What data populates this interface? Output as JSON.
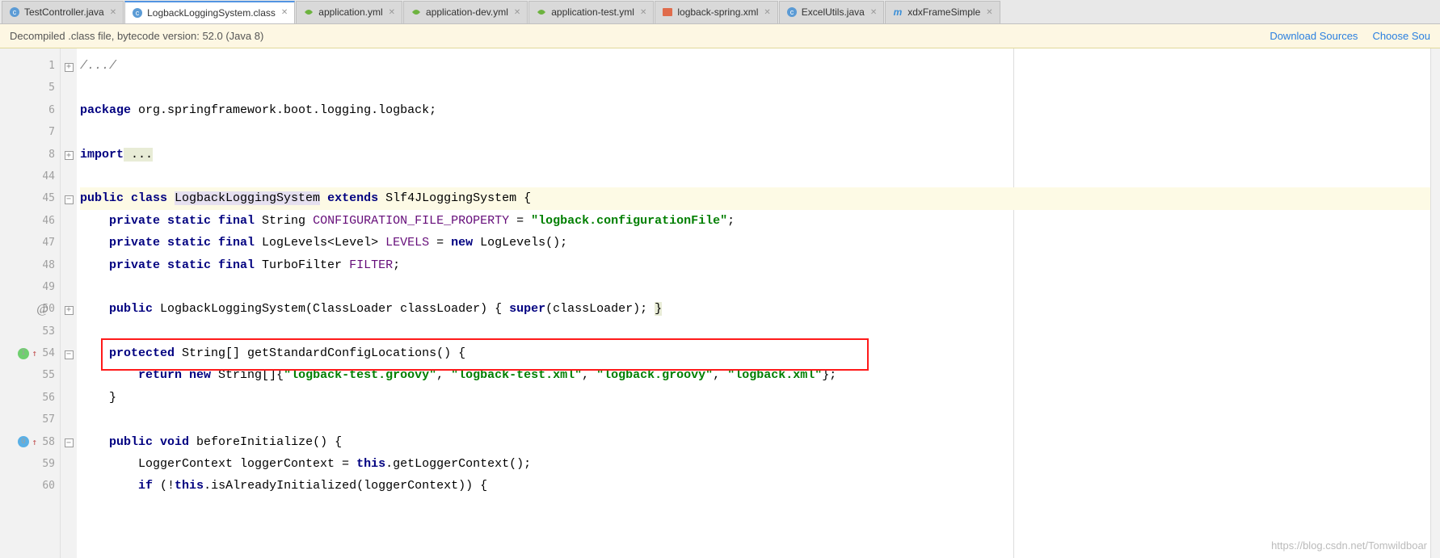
{
  "tabs": [
    {
      "label": "TestController.java",
      "icon": "c-blue",
      "active": false
    },
    {
      "label": "LogbackLoggingSystem.class",
      "icon": "c-blue",
      "active": true
    },
    {
      "label": "application.yml",
      "icon": "leaf",
      "active": false
    },
    {
      "label": "application-dev.yml",
      "icon": "leaf",
      "active": false
    },
    {
      "label": "application-test.yml",
      "icon": "leaf",
      "active": false
    },
    {
      "label": "logback-spring.xml",
      "icon": "xml",
      "active": false
    },
    {
      "label": "ExcelUtils.java",
      "icon": "c-blue",
      "active": false
    },
    {
      "label": "xdxFrameSimple",
      "icon": "m",
      "active": false
    }
  ],
  "notif": {
    "message": "Decompiled .class file, bytecode version: 52.0 (Java 8)",
    "download": "Download Sources",
    "choose": "Choose Sou"
  },
  "line_numbers": [
    "1",
    "5",
    "6",
    "7",
    "8",
    "44",
    "45",
    "46",
    "47",
    "48",
    "49",
    "50",
    "53",
    "54",
    "55",
    "56",
    "57",
    "58",
    "59",
    "60"
  ],
  "code": {
    "l1": "/.../",
    "l6_kw": "package",
    "l6_rest": " org.springframework.boot.logging.logback;",
    "l8_kw": "import",
    "l8_dots": " ...",
    "l45_pre": "public class ",
    "l45_name": "LogbackLoggingSystem",
    "l45_post": " extends Slf4JLoggingSystem {",
    "l46_pre": "    private static final ",
    "l46_type": "String ",
    "l46_id": "CONFIGURATION_FILE_PROPERTY",
    "l46_eq": " = ",
    "l46_str": "\"logback.configurationFile\"",
    "l46_end": ";",
    "l47_pre": "    private static final ",
    "l47_type": "LogLevels<Level> ",
    "l47_id": "LEVELS",
    "l47_eq": " = ",
    "l47_new": "new",
    "l47_post": " LogLevels();",
    "l48_pre": "    private static final ",
    "l48_type": "TurboFilter ",
    "l48_id": "FILTER",
    "l48_end": ";",
    "l50": "    public LogbackLoggingSystem(ClassLoader classLoader) { super(classLoader); }",
    "l50_kw1": "public",
    "l50_kw2": "super",
    "l54_pre": "    protected ",
    "l54_type": "String[] ",
    "l54_name": "getStandardConfigLocations",
    "l54_post": "() {",
    "l55_pre": "        return new ",
    "l55_type": "String[]{",
    "l55_s1": "\"logback-test.groovy\"",
    "l55_s2": "\"logback-test.xml\"",
    "l55_s3": "\"logback.groovy\"",
    "l55_s4": "\"logback.xml\"",
    "l55_end": "};",
    "l56": "    }",
    "l58_pre": "    public void ",
    "l58_name": "beforeInitialize",
    "l58_post": "() {",
    "l59_pre": "        LoggerContext loggerContext = ",
    "l59_this": "this",
    "l59_post": ".getLoggerContext();",
    "l60_pre": "        if (!",
    "l60_this": "this",
    "l60_post": ".isAlreadyInitialized(loggerContext)) {"
  },
  "watermark": "https://blog.csdn.net/Tomwildboar"
}
